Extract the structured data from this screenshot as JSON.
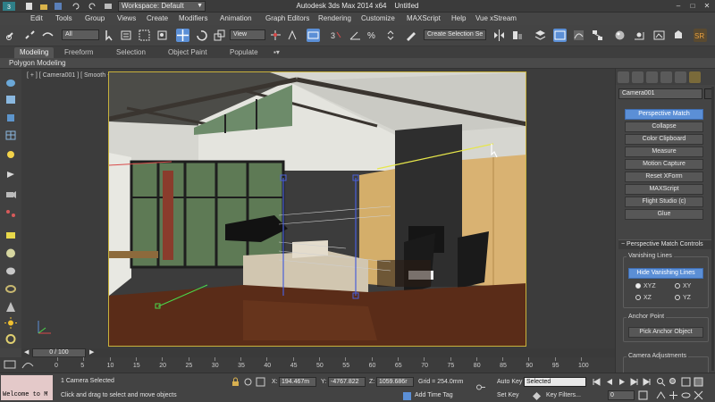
{
  "title_bar": {
    "workspace": "Workspace: Default",
    "app_title": "Autodesk 3ds Max  2014 x64",
    "document": "Untitled",
    "controls": [
      "–",
      "□",
      "✕"
    ]
  },
  "menu": [
    "Edit",
    "Tools",
    "Group",
    "Views",
    "Create",
    "Modifiers",
    "Animation",
    "Graph Editors",
    "Rendering",
    "Customize",
    "MAXScript",
    "Help",
    "Vue xStream"
  ],
  "toolbar": {
    "selection_filter": "All",
    "reference_coord": "View",
    "named_selection": "Create Selection Se"
  },
  "ribbon": {
    "tabs": [
      "Modeling",
      "Freeform",
      "Selection",
      "Object Paint",
      "Populate"
    ],
    "active_tab": "Modeling",
    "sub_label": "Polygon Modeling"
  },
  "viewport": {
    "label": "[ + ] [ Camera001 ] [ Smooth + Highlights ]",
    "frame_color": "#c8b23c"
  },
  "command_panel": {
    "object_name": "Camera001",
    "utility_buttons": [
      "Perspective Match",
      "Collapse",
      "Color Clipboard",
      "Measure",
      "Motion Capture",
      "Reset XForm",
      "MAXScript",
      "Flight Studio (c)",
      "Glue"
    ],
    "active_button": "Perspective Match",
    "rollout_title": "Perspective Match Controls",
    "vanishing_group": "Vanishing Lines",
    "hide_lines_button": "Hide Vanishing Lines",
    "planes": [
      "XYZ",
      "XY",
      "XZ",
      "YZ"
    ],
    "selected_plane": "XYZ",
    "anchor_group": "Anchor Point",
    "pick_anchor_button": "Pick Anchor Object",
    "camera_group": "Camera Adjustments",
    "accent_color": "#5b8fd6"
  },
  "timeline": {
    "slider": "0 / 100",
    "ticks": [
      "0",
      "5",
      "10",
      "15",
      "20",
      "25",
      "30",
      "35",
      "40",
      "45",
      "50",
      "55",
      "60",
      "65",
      "70",
      "75",
      "80",
      "85",
      "90",
      "95",
      "100"
    ]
  },
  "status": {
    "welcome": "Welcome to M",
    "selection_info": "1 Camera Selected",
    "prompt": "Click and drag to select and move objects",
    "x_label": "X:",
    "x_value": "194.467m",
    "y_label": "Y:",
    "y_value": "-4767.822",
    "z_label": "Z:",
    "z_value": "1059.686r",
    "grid": "Grid = 254.0mm",
    "add_time_tag": "Add Time Tag",
    "auto_key": "Auto Key",
    "key_mode": "Selected",
    "set_key": "Set Key",
    "key_filters": "Key Filters...",
    "frame": "0"
  }
}
